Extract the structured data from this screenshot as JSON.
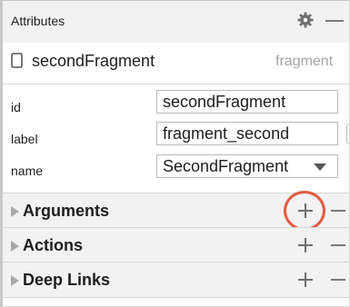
{
  "panel": {
    "title": "Attributes",
    "header_icons": [
      "gear-icon",
      "minus-icon"
    ]
  },
  "destination": {
    "icon": "document-icon",
    "name": "secondFragment",
    "type": "fragment"
  },
  "properties": {
    "id": {
      "label": "id",
      "value": "secondFragment"
    },
    "label": {
      "label": "label",
      "value": "fragment_second"
    },
    "name": {
      "label": "name",
      "value": "SecondFragment"
    }
  },
  "sections": [
    {
      "label": "Arguments",
      "highlighted": true
    },
    {
      "label": "Actions",
      "highlighted": false
    },
    {
      "label": "Deep Links",
      "highlighted": false
    }
  ],
  "colors": {
    "highlight_ring": "#e25a43",
    "header_bg": "#f2f2f2",
    "secondary_text": "#a6a6a6"
  }
}
